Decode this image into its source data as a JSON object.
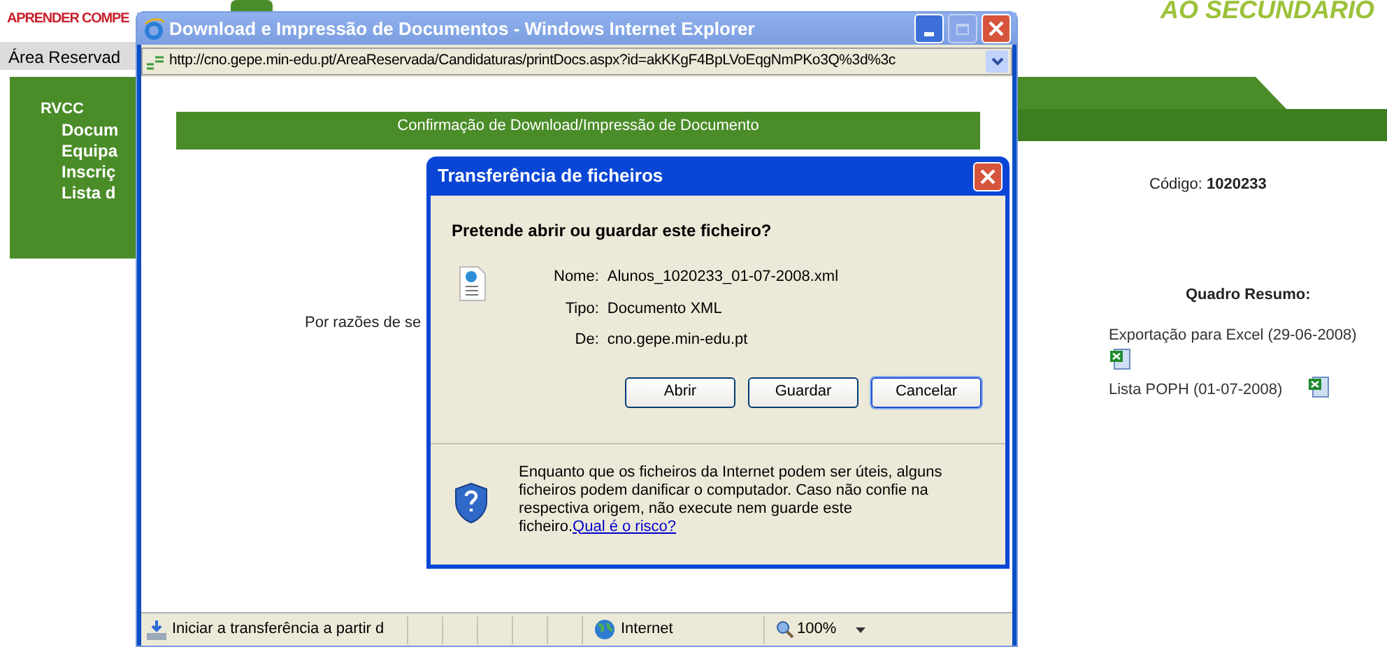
{
  "page": {
    "brand": "APRENDER COMPE",
    "tagline": "AO SECUNDARIO",
    "area_title": "Área Reservad",
    "sidebar": {
      "items": [
        {
          "label": "RVCC",
          "children": [
            {
              "label": "Docum"
            },
            {
              "label": "Equipa"
            },
            {
              "label": "Inscriç"
            },
            {
              "label": "Lista d"
            }
          ]
        }
      ]
    },
    "code": {
      "label": "Código:",
      "value": "1020233"
    },
    "summary": {
      "title": "Quadro Resumo:",
      "links": [
        {
          "label": "Exportação para Excel (29-06-2008)",
          "icon_below": true
        },
        {
          "label": "Lista POPH (01-07-2008)",
          "icon_below": false
        }
      ]
    }
  },
  "browser_window": {
    "title": "Download e Impressão de Documentos - Windows Internet Explorer",
    "address": "http://cno.gepe.min-edu.pt/AreaReservada/Candidaturas/printDocs.aspx?id=akKKgF4BpLVoEqgNmPKo3Q%3d%3c",
    "banner": "Confirmação de Download/Impressão de Documento",
    "body_text": "Por razões de se",
    "status_bar": {
      "message": "Iniciar a transferência a partir d",
      "zone": "Internet",
      "zoom": "100%"
    }
  },
  "dialog": {
    "title": "Transferência de ficheiros",
    "question": "Pretende abrir ou guardar este ficheiro?",
    "fields": [
      {
        "label": "Nome:",
        "value": "Alunos_1020233_01-07-2008.xml"
      },
      {
        "label": "Tipo:",
        "value": "Documento XML"
      },
      {
        "label": "De:",
        "value": "cno.gepe.min-edu.pt"
      }
    ],
    "buttons": [
      {
        "label": "Abrir",
        "focused": false
      },
      {
        "label": "Guardar",
        "focused": false
      },
      {
        "label": "Cancelar",
        "focused": true
      }
    ],
    "warning": "Enquanto que os ficheiros da Internet podem ser úteis, alguns ficheiros podem danificar o computador. Caso não confie na respectiva origem, não execute nem guarde este ficheiro.",
    "warning_link": "Qual é o risco?"
  }
}
